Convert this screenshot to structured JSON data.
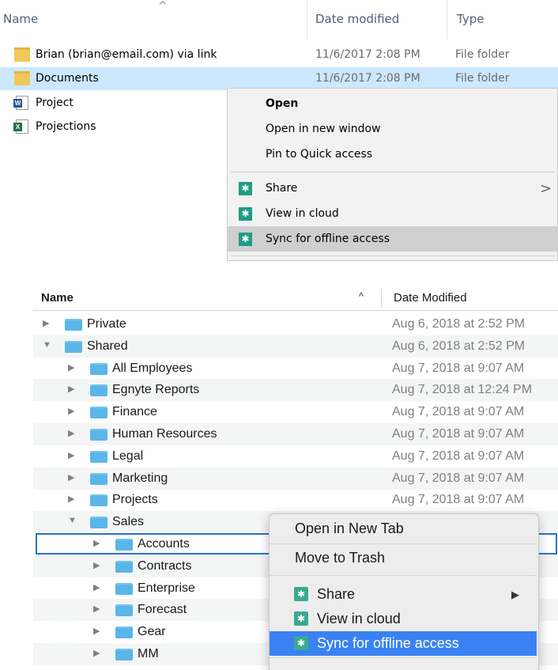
{
  "windows_explorer": {
    "columns": {
      "name": "Name",
      "date": "Date modified",
      "type": "Type"
    },
    "sort_glyph": "^",
    "rows": [
      {
        "name": "Brian (brian@email.com) via link",
        "date": "11/6/2017 2:08 PM",
        "type": "File folder",
        "icon": "folder-icon"
      },
      {
        "name": "Documents",
        "date": "11/6/2017 2:08 PM",
        "type": "File folder",
        "icon": "folder-icon",
        "selected": true
      },
      {
        "name": "Project",
        "date": "",
        "type": "",
        "icon": "word-document-icon"
      },
      {
        "name": "Projections",
        "date": "",
        "type": "",
        "icon": "excel-document-icon"
      }
    ],
    "context_menu": {
      "open": "Open",
      "open_new_window": "Open in new window",
      "pin_quick_access": "Pin to Quick access",
      "share": "Share",
      "view_in_cloud": "View in cloud",
      "sync_offline": "Sync for offline access",
      "submenu_glyph": ">",
      "item_icon": "egnyte-icon",
      "icon_glyph": "✱"
    }
  },
  "mac_finder": {
    "columns": {
      "name": "Name",
      "date": "Date Modified"
    },
    "sort_glyph": "^",
    "rows": [
      {
        "name": "Private",
        "date": "Aug 6, 2018 at 2:52 PM",
        "expanded": false
      },
      {
        "name": "Shared",
        "date": "Aug 6, 2018 at 2:52 PM",
        "expanded": true
      },
      {
        "name": "All Employees",
        "date": "Aug 7, 2018 at 9:07 AM"
      },
      {
        "name": "Egnyte Reports",
        "date": "Aug 7, 2018 at 12:24 PM"
      },
      {
        "name": "Finance",
        "date": "Aug 7, 2018 at 9:07 AM"
      },
      {
        "name": "Human Resources",
        "date": "Aug 7, 2018 at 9:07 AM"
      },
      {
        "name": "Legal",
        "date": "Aug 7, 2018 at 9:07 AM"
      },
      {
        "name": "Marketing",
        "date": "Aug 7, 2018 at 9:07 AM"
      },
      {
        "name": "Projects",
        "date": "Aug 7, 2018 at 9:07 AM"
      },
      {
        "name": "Sales",
        "date": "",
        "expanded": true
      },
      {
        "name": "Accounts",
        "date": "",
        "selected": true
      },
      {
        "name": "Contracts",
        "date": ""
      },
      {
        "name": "Enterprise",
        "date": ""
      },
      {
        "name": "Forecast",
        "date": ""
      },
      {
        "name": "Gear",
        "date": ""
      },
      {
        "name": "MM",
        "date": ""
      }
    ],
    "collapsed_glyph": "▶",
    "expanded_glyph": "▼",
    "context_menu": {
      "open_new_tab": "Open in New Tab",
      "move_to_trash": "Move to Trash",
      "share": "Share",
      "view_in_cloud": "View in cloud",
      "sync_offline": "Sync for offline access",
      "submenu_glyph": "▶",
      "icon_glyph": "✱"
    }
  },
  "colors": {
    "win_selection": "#cce8ff",
    "win_menu_highlight": "#cfcfcf",
    "mac_selection": "#3a82f4",
    "mac_focus_ring": "#2a6fd1",
    "folder_blue": "#5ab6e8",
    "folder_yellow": "#f2c75c"
  }
}
